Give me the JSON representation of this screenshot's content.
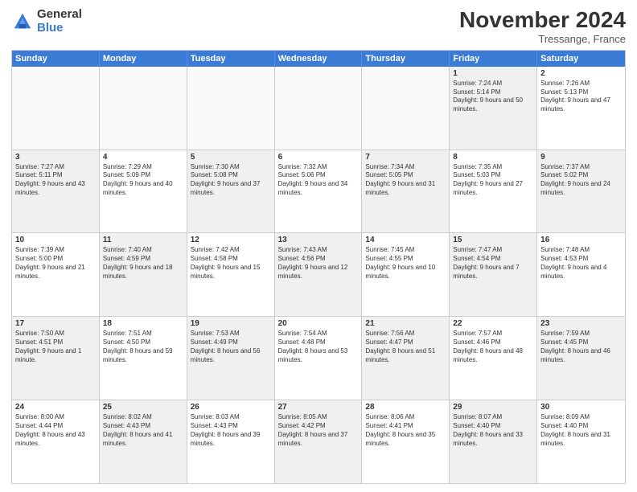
{
  "logo": {
    "general": "General",
    "blue": "Blue"
  },
  "header": {
    "title": "November 2024",
    "location": "Tressange, France"
  },
  "weekdays": [
    "Sunday",
    "Monday",
    "Tuesday",
    "Wednesday",
    "Thursday",
    "Friday",
    "Saturday"
  ],
  "rows": [
    [
      {
        "day": "",
        "text": "",
        "empty": true
      },
      {
        "day": "",
        "text": "",
        "empty": true
      },
      {
        "day": "",
        "text": "",
        "empty": true
      },
      {
        "day": "",
        "text": "",
        "empty": true
      },
      {
        "day": "",
        "text": "",
        "empty": true
      },
      {
        "day": "1",
        "text": "Sunrise: 7:24 AM\nSunset: 5:14 PM\nDaylight: 9 hours and 50 minutes.",
        "shaded": true
      },
      {
        "day": "2",
        "text": "Sunrise: 7:26 AM\nSunset: 5:13 PM\nDaylight: 9 hours and 47 minutes.",
        "shaded": false
      }
    ],
    [
      {
        "day": "3",
        "text": "Sunrise: 7:27 AM\nSunset: 5:11 PM\nDaylight: 9 hours and 43 minutes.",
        "shaded": true
      },
      {
        "day": "4",
        "text": "Sunrise: 7:29 AM\nSunset: 5:09 PM\nDaylight: 9 hours and 40 minutes.",
        "shaded": false
      },
      {
        "day": "5",
        "text": "Sunrise: 7:30 AM\nSunset: 5:08 PM\nDaylight: 9 hours and 37 minutes.",
        "shaded": true
      },
      {
        "day": "6",
        "text": "Sunrise: 7:32 AM\nSunset: 5:06 PM\nDaylight: 9 hours and 34 minutes.",
        "shaded": false
      },
      {
        "day": "7",
        "text": "Sunrise: 7:34 AM\nSunset: 5:05 PM\nDaylight: 9 hours and 31 minutes.",
        "shaded": true
      },
      {
        "day": "8",
        "text": "Sunrise: 7:35 AM\nSunset: 5:03 PM\nDaylight: 9 hours and 27 minutes.",
        "shaded": false
      },
      {
        "day": "9",
        "text": "Sunrise: 7:37 AM\nSunset: 5:02 PM\nDaylight: 9 hours and 24 minutes.",
        "shaded": true
      }
    ],
    [
      {
        "day": "10",
        "text": "Sunrise: 7:39 AM\nSunset: 5:00 PM\nDaylight: 9 hours and 21 minutes.",
        "shaded": false
      },
      {
        "day": "11",
        "text": "Sunrise: 7:40 AM\nSunset: 4:59 PM\nDaylight: 9 hours and 18 minutes.",
        "shaded": true
      },
      {
        "day": "12",
        "text": "Sunrise: 7:42 AM\nSunset: 4:58 PM\nDaylight: 9 hours and 15 minutes.",
        "shaded": false
      },
      {
        "day": "13",
        "text": "Sunrise: 7:43 AM\nSunset: 4:56 PM\nDaylight: 9 hours and 12 minutes.",
        "shaded": true
      },
      {
        "day": "14",
        "text": "Sunrise: 7:45 AM\nSunset: 4:55 PM\nDaylight: 9 hours and 10 minutes.",
        "shaded": false
      },
      {
        "day": "15",
        "text": "Sunrise: 7:47 AM\nSunset: 4:54 PM\nDaylight: 9 hours and 7 minutes.",
        "shaded": true
      },
      {
        "day": "16",
        "text": "Sunrise: 7:48 AM\nSunset: 4:53 PM\nDaylight: 9 hours and 4 minutes.",
        "shaded": false
      }
    ],
    [
      {
        "day": "17",
        "text": "Sunrise: 7:50 AM\nSunset: 4:51 PM\nDaylight: 9 hours and 1 minute.",
        "shaded": true
      },
      {
        "day": "18",
        "text": "Sunrise: 7:51 AM\nSunset: 4:50 PM\nDaylight: 8 hours and 59 minutes.",
        "shaded": false
      },
      {
        "day": "19",
        "text": "Sunrise: 7:53 AM\nSunset: 4:49 PM\nDaylight: 8 hours and 56 minutes.",
        "shaded": true
      },
      {
        "day": "20",
        "text": "Sunrise: 7:54 AM\nSunset: 4:48 PM\nDaylight: 8 hours and 53 minutes.",
        "shaded": false
      },
      {
        "day": "21",
        "text": "Sunrise: 7:56 AM\nSunset: 4:47 PM\nDaylight: 8 hours and 51 minutes.",
        "shaded": true
      },
      {
        "day": "22",
        "text": "Sunrise: 7:57 AM\nSunset: 4:46 PM\nDaylight: 8 hours and 48 minutes.",
        "shaded": false
      },
      {
        "day": "23",
        "text": "Sunrise: 7:59 AM\nSunset: 4:45 PM\nDaylight: 8 hours and 46 minutes.",
        "shaded": true
      }
    ],
    [
      {
        "day": "24",
        "text": "Sunrise: 8:00 AM\nSunset: 4:44 PM\nDaylight: 8 hours and 43 minutes.",
        "shaded": false
      },
      {
        "day": "25",
        "text": "Sunrise: 8:02 AM\nSunset: 4:43 PM\nDaylight: 8 hours and 41 minutes.",
        "shaded": true
      },
      {
        "day": "26",
        "text": "Sunrise: 8:03 AM\nSunset: 4:43 PM\nDaylight: 8 hours and 39 minutes.",
        "shaded": false
      },
      {
        "day": "27",
        "text": "Sunrise: 8:05 AM\nSunset: 4:42 PM\nDaylight: 8 hours and 37 minutes.",
        "shaded": true
      },
      {
        "day": "28",
        "text": "Sunrise: 8:06 AM\nSunset: 4:41 PM\nDaylight: 8 hours and 35 minutes.",
        "shaded": false
      },
      {
        "day": "29",
        "text": "Sunrise: 8:07 AM\nSunset: 4:40 PM\nDaylight: 8 hours and 33 minutes.",
        "shaded": true
      },
      {
        "day": "30",
        "text": "Sunrise: 8:09 AM\nSunset: 4:40 PM\nDaylight: 8 hours and 31 minutes.",
        "shaded": false
      }
    ]
  ]
}
